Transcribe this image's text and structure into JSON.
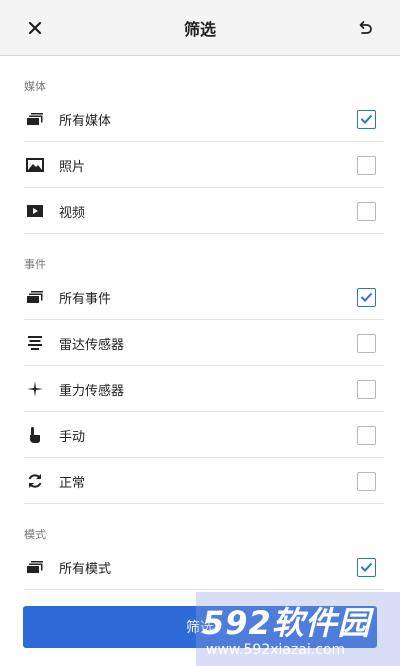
{
  "header": {
    "title": "筛选",
    "close_icon": "close-icon",
    "reset_icon": "undo-icon"
  },
  "sections": [
    {
      "label": "媒体",
      "items": [
        {
          "label": "所有媒体",
          "icon": "stack-icon",
          "checked": true
        },
        {
          "label": "照片",
          "icon": "photo-icon",
          "checked": false
        },
        {
          "label": "视频",
          "icon": "video-icon",
          "checked": false
        }
      ]
    },
    {
      "label": "事件",
      "items": [
        {
          "label": "所有事件",
          "icon": "stack-icon",
          "checked": true
        },
        {
          "label": "雷达传感器",
          "icon": "radar-icon",
          "checked": false
        },
        {
          "label": "重力传感器",
          "icon": "gravity-icon",
          "checked": false
        },
        {
          "label": "手动",
          "icon": "hand-icon",
          "checked": false
        },
        {
          "label": "正常",
          "icon": "refresh-icon",
          "checked": false
        }
      ]
    },
    {
      "label": "模式",
      "items": [
        {
          "label": "所有模式",
          "icon": "stack-icon",
          "checked": true
        }
      ]
    }
  ],
  "apply_button": {
    "label": "筛选"
  },
  "watermark": {
    "main": "592软件园",
    "sub": "www.592xiazai.com"
  },
  "colors": {
    "accent": "#2e6ad8",
    "header_bg": "#f4f4f4"
  }
}
